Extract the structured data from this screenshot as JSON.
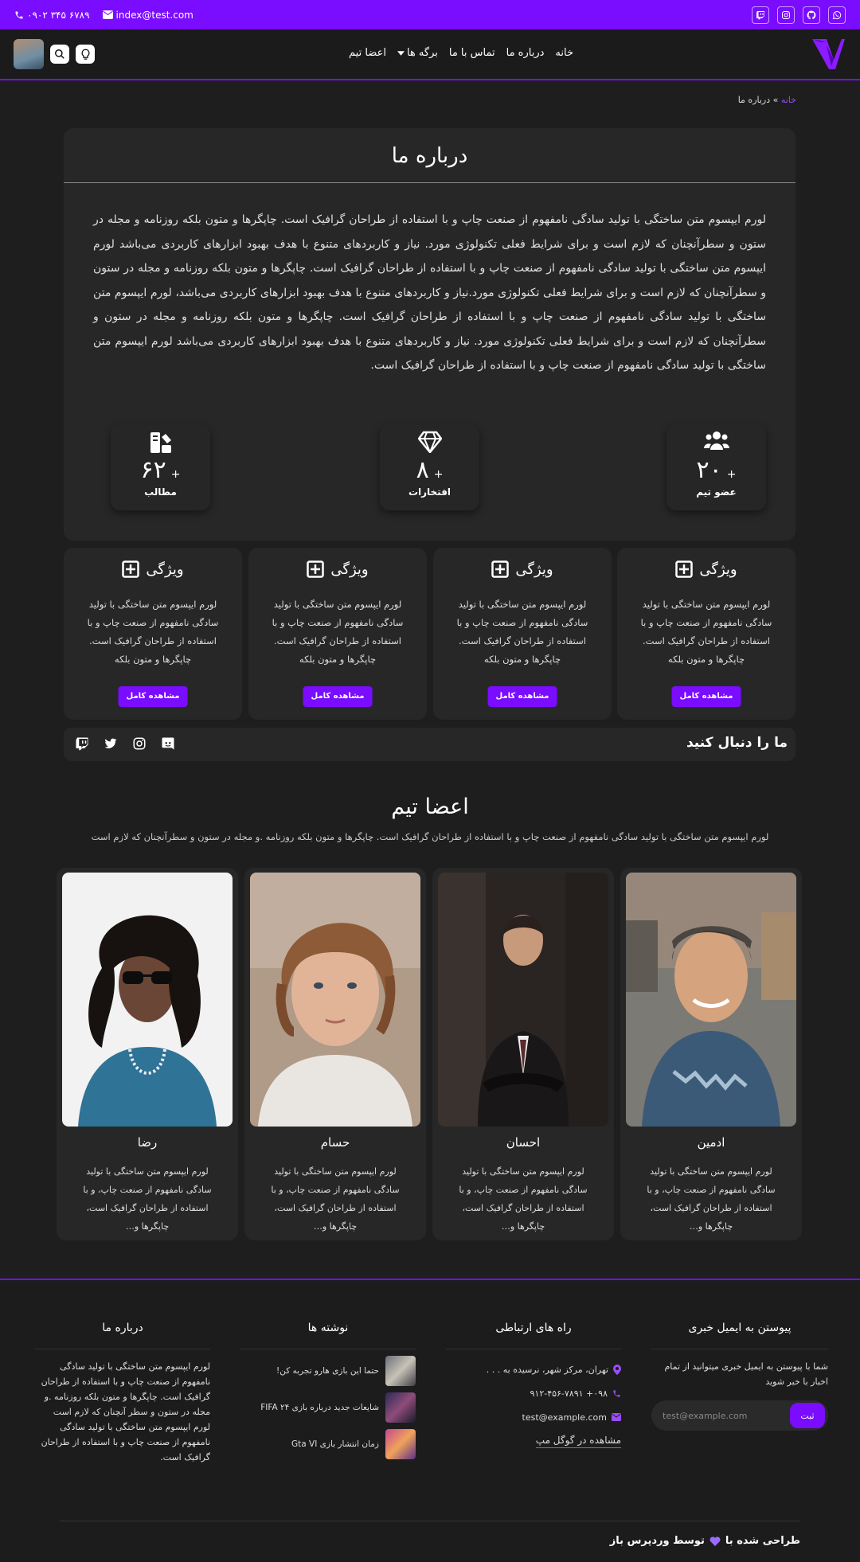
{
  "topbar": {
    "phone": "۰۹۰۲ ۳۴۵ ۶۷۸۹",
    "email": "index@test.com",
    "socials": [
      "twitch-icon",
      "instagram-icon",
      "github-icon",
      "whatsapp-icon"
    ]
  },
  "nav": {
    "menu": [
      "خانه",
      "درباره ما",
      "تماس با ما",
      "برگه ها",
      "اعضا تیم"
    ]
  },
  "breadcrumb": {
    "home": "خانه",
    "sep": "»",
    "current": "درباره ما"
  },
  "about": {
    "title": "درباره ما",
    "body": "لورم ایپسوم متن ساختگی با تولید سادگی نامفهوم از صنعت چاپ و با استفاده از طراحان گرافیک است. چاپگرها و متون بلکه روزنامه و مجله در ستون و سطرآنچنان که لازم است و برای شرایط فعلی تکنولوژی مورد. نیاز و کاربردهای متنوع با هدف بهبود ابزارهای کاربردی می‌باشد لورم ایپسوم متن ساختگی با تولید سادگی نامفهوم از صنعت چاپ و با استفاده از طراحان گرافیک است. چاپگرها و متون بلکه روزنامه و مجله در ستون و سطرآنچنان که لازم است و برای شرایط فعلی تکنولوژی مورد.نیاز و کاربردهای متنوع با هدف بهبود ابزارهای کاربردی می‌باشد، لورم ایپسوم متن ساختگی با تولید سادگی نامفهوم از صنعت چاپ و با استفاده از طراحان گرافیک است. چاپگرها و متون بلکه روزنامه و مجله در ستون و سطرآنچنان که لازم است و برای شرایط فعلی تکنولوژی مورد. نیاز و کاربردهای متنوع با هدف بهبود ابزارهای کاربردی می‌باشد لورم ایپسوم متن ساختگی با تولید سادگی نامفهوم از صنعت چاپ و با استفاده از طراحان گرافیک است.",
    "stats": [
      {
        "icon": "users-icon",
        "value": "۲۰",
        "plus": "+",
        "label": "عضو تیم"
      },
      {
        "icon": "diamond-icon",
        "value": "۸",
        "plus": "+",
        "label": "افتخارات"
      },
      {
        "icon": "articles-icon",
        "value": "۶۲",
        "plus": "+",
        "label": "مطالب"
      }
    ]
  },
  "features": [
    {
      "title": "ویژگی",
      "text": "لورم ایپسوم متن ساختگی با تولید سادگی نامفهوم از صنعت چاپ و با استفاده از طراحان گرافیک است. چاپگرها و متون بلکه",
      "button": "مشاهده کامل"
    },
    {
      "title": "ویژگی",
      "text": "لورم ایپسوم متن ساختگی با تولید سادگی نامفهوم از صنعت چاپ و با استفاده از طراحان گرافیک است. چاپگرها و متون بلکه",
      "button": "مشاهده کامل"
    },
    {
      "title": "ویژگی",
      "text": "لورم ایپسوم متن ساختگی با تولید سادگی نامفهوم از صنعت چاپ و با استفاده از طراحان گرافیک است. چاپگرها و متون بلکه",
      "button": "مشاهده کامل"
    },
    {
      "title": "ویژگی",
      "text": "لورم ایپسوم متن ساختگی با تولید سادگی نامفهوم از صنعت چاپ و با استفاده از طراحان گرافیک است. چاپگرها و متون بلکه",
      "button": "مشاهده کامل"
    }
  ],
  "follow": {
    "title": "ما را دنبال کنید",
    "icons": [
      "discord-icon",
      "instagram-icon",
      "twitter-icon",
      "twitch-icon"
    ]
  },
  "team": {
    "title": "اعضا تیم",
    "subtitle": "لورم ایپسوم متن ساختگی با تولید سادگی نامفهوم از صنعت چاپ و با استفاده از طراحان گرافیک است. چاپگرها و متون بلکه روزنامه .و مجله در ستون و سطرآنچنان که لازم است",
    "members": [
      {
        "name": "ادمین",
        "text": "لورم ایپسوم متن ساختگی با تولید سادگی نامفهوم از صنعت چاپ، و با استفاده از طراحان گرافیک است، چاپگرها و…"
      },
      {
        "name": "احسان",
        "text": "لورم ایپسوم متن ساختگی با تولید سادگی نامفهوم از صنعت چاپ، و با استفاده از طراحان گرافیک است، چاپگرها و…"
      },
      {
        "name": "حسام",
        "text": "لورم ایپسوم متن ساختگی با تولید سادگی نامفهوم از صنعت چاپ، و با استفاده از طراحان گرافیک است، چاپگرها و…"
      },
      {
        "name": "رضا",
        "text": "لورم ایپسوم متن ساختگی با تولید سادگی نامفهوم از صنعت چاپ، و با استفاده از طراحان گرافیک است، چاپگرها و…"
      }
    ]
  },
  "footer": {
    "newsletter": {
      "title": "پیوستن به ایمیل خبری",
      "text": "شما با پیوستن به ایمیل خبری میتوانید از تمام اخبار با خبر شوید",
      "placeholder": "test@example.com",
      "button": "ثبت"
    },
    "contact": {
      "title": "راه های ارتباطی",
      "address": "تهران، مرکز شهر، نرسیده به . . .",
      "phone": "۰۹۸+ ۹۱۲-۴۵۶-۷۸۹۱",
      "email": "test@example.com",
      "map": "مشاهده در گوگل مپ"
    },
    "posts": {
      "title": "نوشته ها",
      "items": [
        "حتما این بازی هارو تجربه کن!",
        "شایعات جدید درباره بازی FIFA ۲۴",
        "زمان انتشار بازی Gta VI"
      ]
    },
    "about": {
      "title": "درباره ما",
      "text": "لورم ایپسوم متن ساختگی با تولید سادگی نامفهوم از صنعت چاپ و با استفاده از طراحان گرافیک است. چاپگرها و متون بلکه روزنامه .و مجله در ستون و سطر آنچنان که لازم است لورم ایپسوم متن ساختگی با تولید سادگی نامفهوم از صنعت چاپ و با استفاده از طراحان گرافیک است."
    },
    "credit_before": "طراحی شده با",
    "credit_after": "توسط وردپرس باز"
  },
  "colors": {
    "accent": "#7a0cff",
    "bg": "#1e1e1f",
    "card": "#272728"
  }
}
